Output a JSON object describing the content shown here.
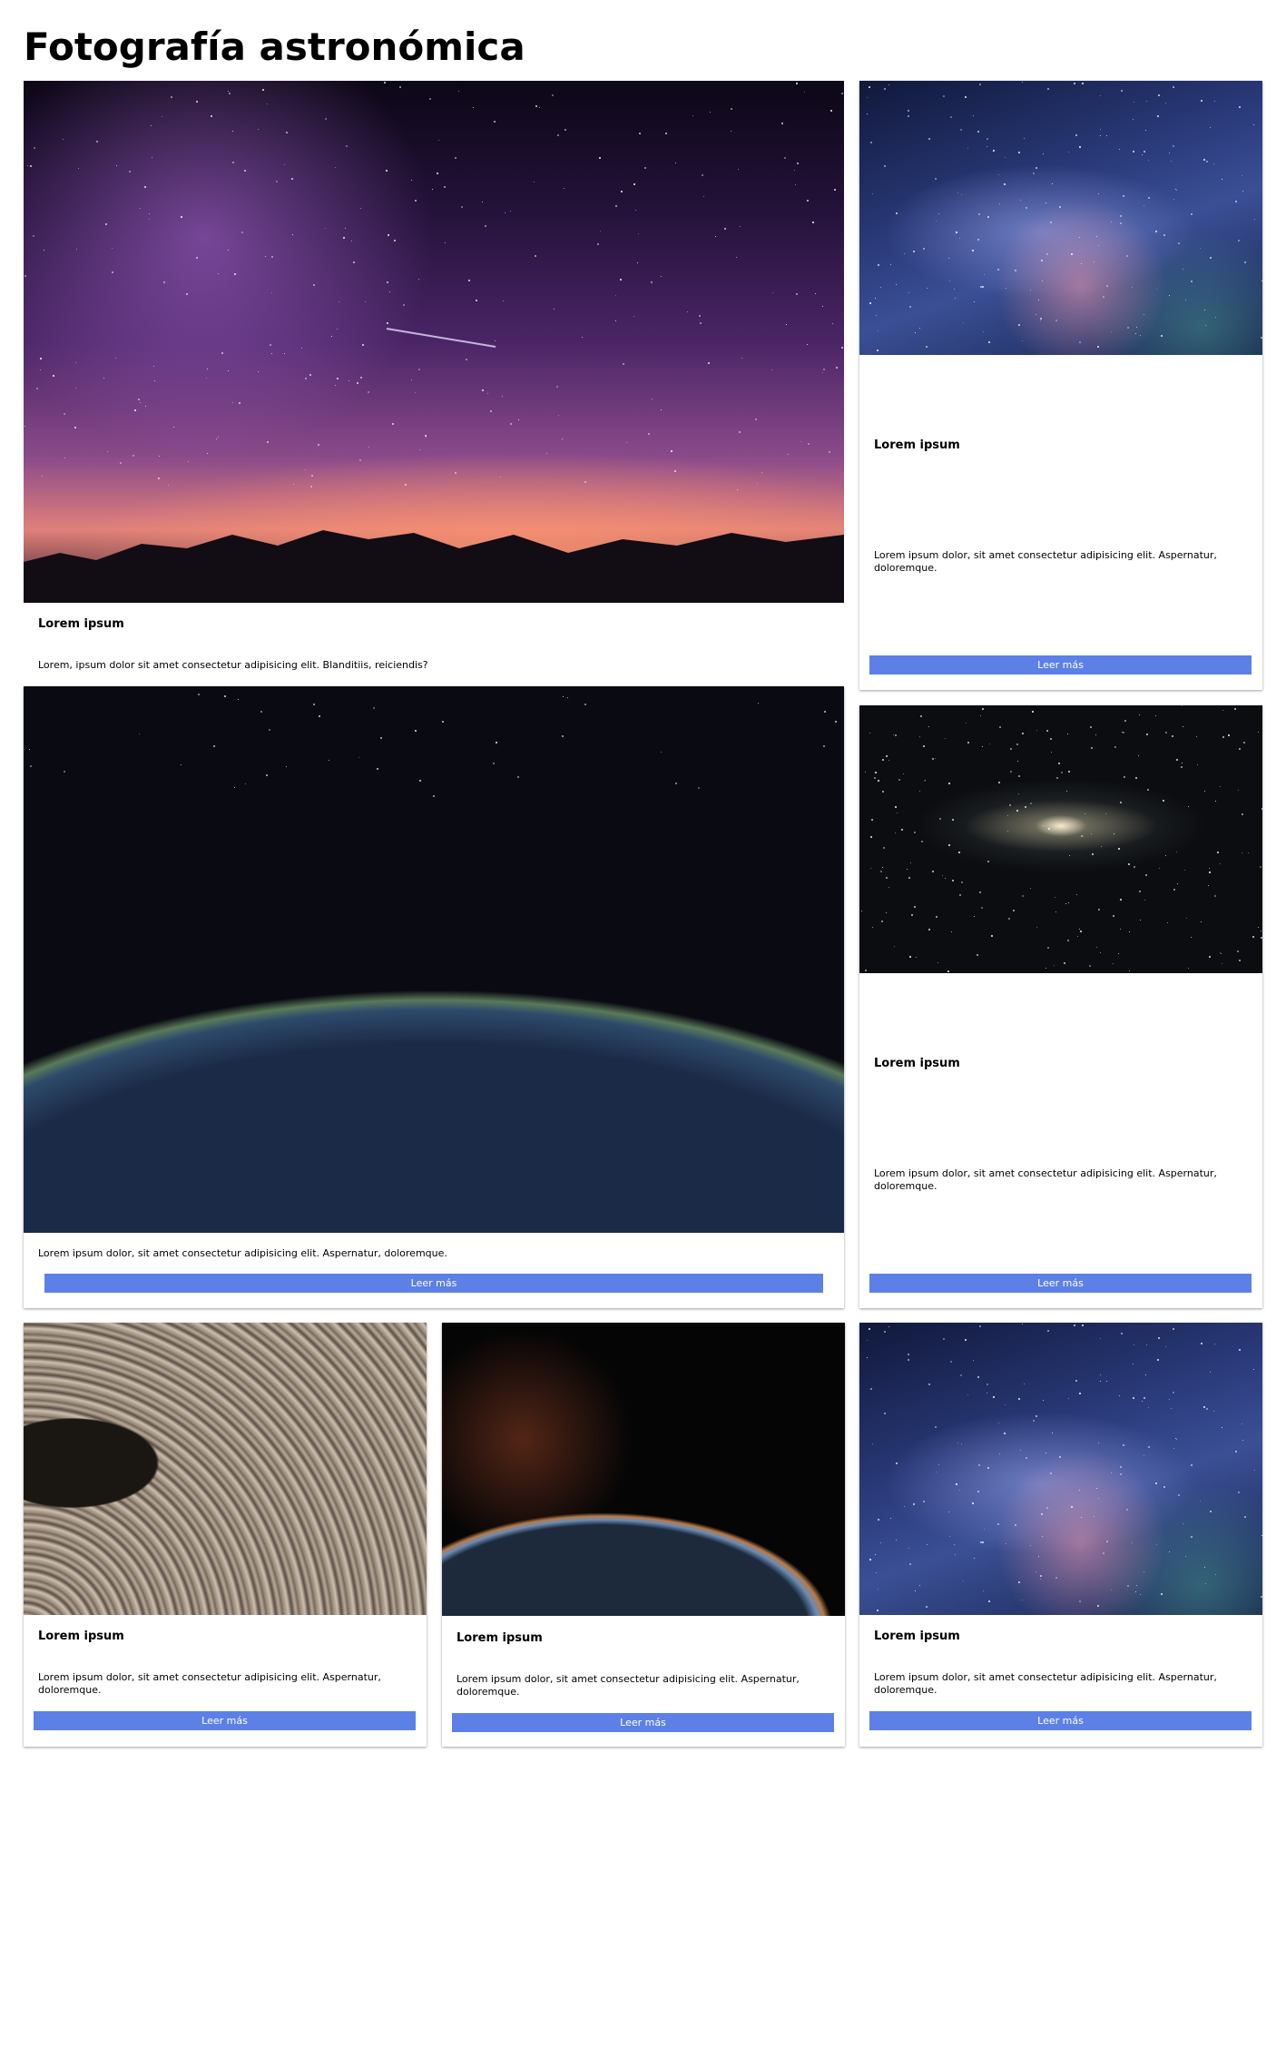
{
  "page": {
    "title": "Fotografía astronómica"
  },
  "cards": [
    {
      "title": "Lorem ipsum",
      "text": "Lorem, ipsum dolor sit amet consectetur adipisicing elit. Blanditiis, reiciendis?"
    },
    {
      "title": "Lorem ipsum",
      "text": "Lorem ipsum dolor, sit amet consectetur adipisicing elit. Aspernatur, doloremque.",
      "button": "Leer más"
    },
    {
      "text": "Lorem ipsum dolor, sit amet consectetur adipisicing elit. Aspernatur, doloremque.",
      "button": "Leer más"
    },
    {
      "title": "Lorem ipsum",
      "text": "Lorem ipsum dolor, sit amet consectetur adipisicing elit. Aspernatur, doloremque.",
      "button": "Leer más"
    },
    {
      "title": "Lorem ipsum",
      "text": "Lorem ipsum dolor, sit amet consectetur adipisicing elit. Aspernatur, doloremque.",
      "button": "Leer más"
    },
    {
      "title": "Lorem ipsum",
      "text": "Lorem ipsum dolor, sit amet consectetur adipisicing elit. Aspernatur, doloremque.",
      "button": "Leer más"
    },
    {
      "title": "Lorem ipsum",
      "text": "Lorem ipsum dolor, sit amet consectetur adipisicing elit. Aspernatur, doloremque.",
      "button": "Leer más"
    }
  ],
  "images": {
    "card1": "starry-night-sky-photo",
    "card2": "milky-way-photo",
    "card3": "earth-night-lights-photo",
    "card4": "andromeda-galaxy-photo",
    "card5": "saturn-rings-photo",
    "card6": "planet-horizon-photo",
    "card7": "milky-way-photo"
  }
}
